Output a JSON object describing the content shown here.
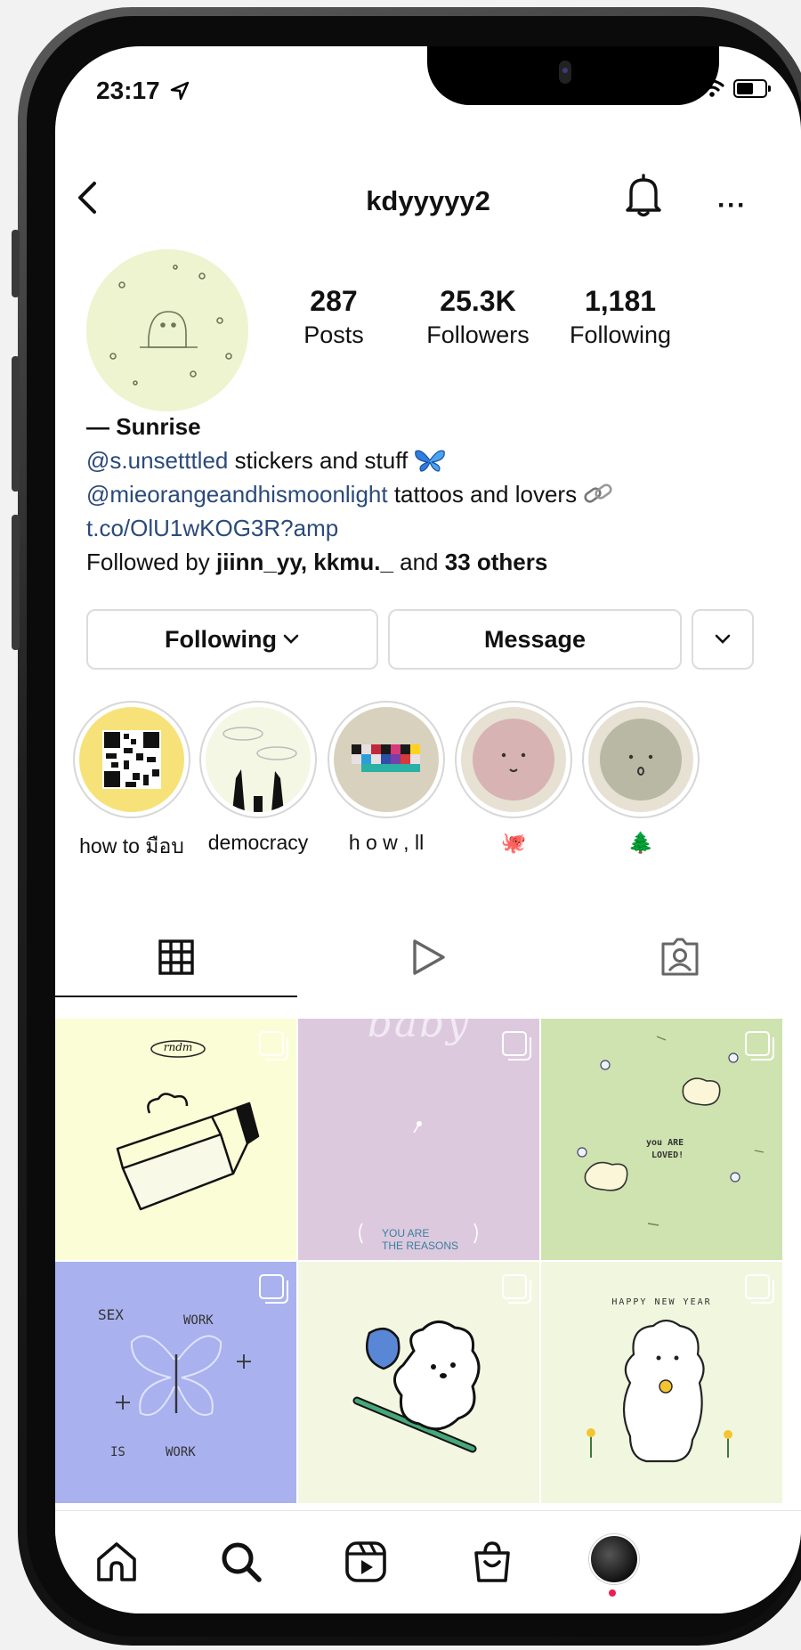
{
  "status_bar": {
    "time": "23:17"
  },
  "header": {
    "username": "kdyyyyy2"
  },
  "profile": {
    "stats": [
      {
        "value": "287",
        "label": "Posts"
      },
      {
        "value": "25.3K",
        "label": "Followers"
      },
      {
        "value": "1,181",
        "label": "Following"
      }
    ],
    "bio": {
      "name": "— Sunrise",
      "line1_mention": "@s.unsetttled",
      "line1_text": " stickers and stuff ",
      "line2_mention": "@mieorangeandhismoonlight",
      "line2_text": " tattoos and lovers ",
      "link": "t.co/OlU1wKOG3R?amp",
      "followed_prefix": "Followed by ",
      "followed_users": "jiinn_yy, kkmu._",
      "followed_and": " and ",
      "followed_others": "33 others"
    }
  },
  "actions": {
    "following_label": "Following",
    "message_label": "Message"
  },
  "highlights": [
    {
      "label": "how to มือบ"
    },
    {
      "label": "democracy"
    },
    {
      "label": "h o w , ll"
    },
    {
      "label": "🐙"
    },
    {
      "label": "🌲"
    }
  ],
  "posts": [
    {
      "text": "rndm"
    },
    {
      "text_top": "baby",
      "text_bottom_1": "YOU ARE",
      "text_bottom_2": "THE REASONS"
    },
    {
      "text_1": "you ARE",
      "text_2": "LOVED!"
    },
    {
      "text_1": "SEX",
      "text_2": "WORK",
      "text_3": "IS",
      "text_4": "WORK"
    },
    {
      "text": ""
    },
    {
      "text": "HAPPY NEW YEAR"
    }
  ],
  "colors": {
    "mention": "#2b4a7b",
    "post1_bg": "#fbfdd6",
    "post2_bg": "#ddc9de",
    "post3_bg": "#cfe3b0",
    "post4_bg": "#a9b2ee",
    "post5_bg": "#f3f7e2",
    "post6_bg": "#f1f6df",
    "notification_dot": "#ee1d52"
  },
  "icons": {
    "back": "chevron-left-icon",
    "bell": "bell-icon",
    "more": "more-icon",
    "grid": "grid-icon",
    "reels": "reels-play-icon",
    "tagged": "tagged-icon",
    "home": "home-icon",
    "search": "search-icon",
    "reels_nav": "reels-icon",
    "shop": "shop-bag-icon"
  }
}
